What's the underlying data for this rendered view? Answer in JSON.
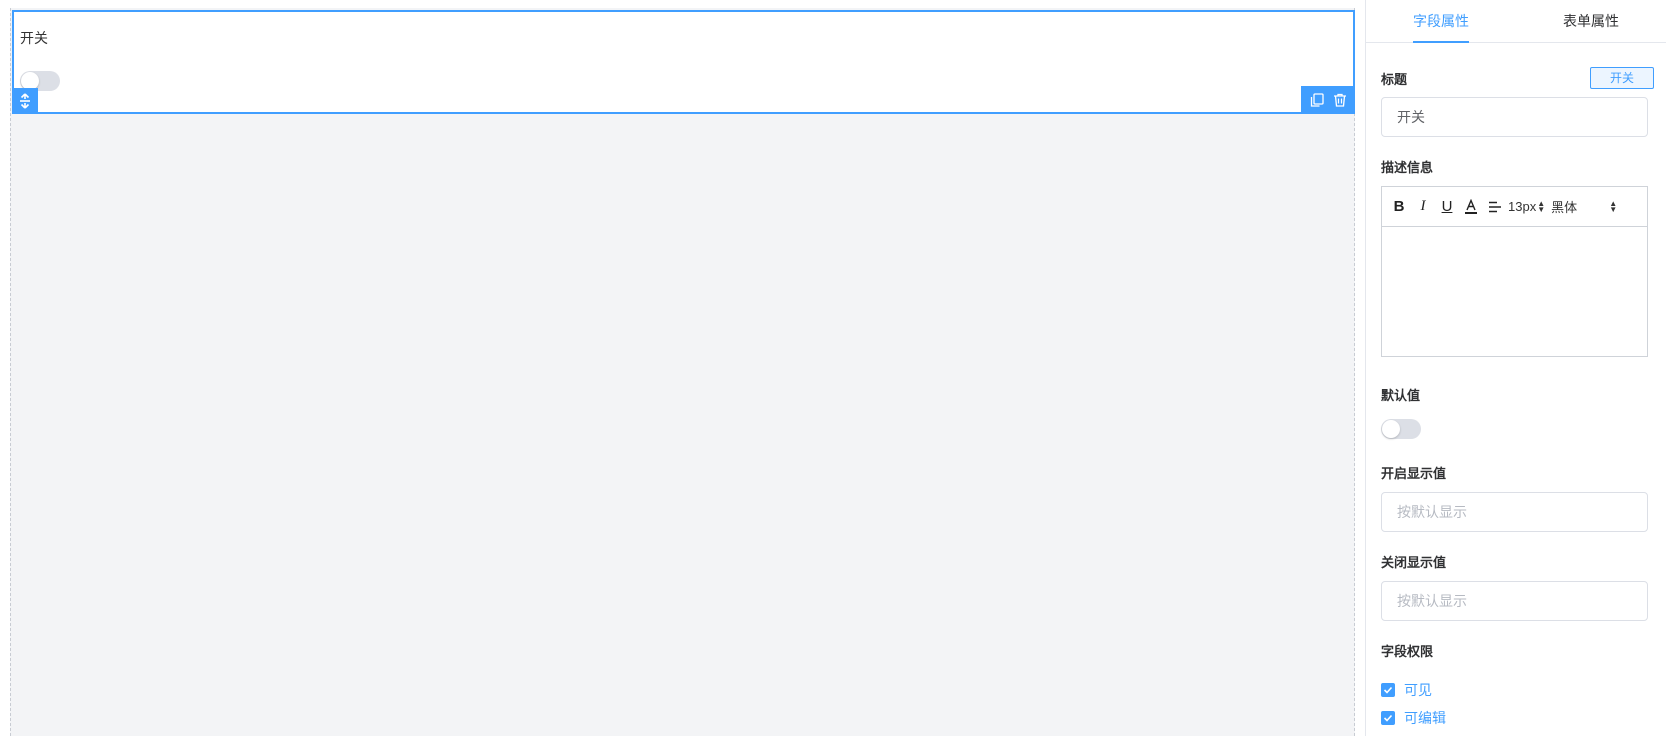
{
  "canvas": {
    "field_label": "开关"
  },
  "panel": {
    "tabs": [
      {
        "label": "字段属性",
        "active": true
      },
      {
        "label": "表单属性",
        "active": false
      }
    ],
    "title_label": "标题",
    "type_badge": "开关",
    "title_value": "开关",
    "desc_label": "描述信息",
    "editor": {
      "bold": "B",
      "italic": "I",
      "underline": "U",
      "color": "A",
      "font_size": "13px",
      "font_family": "黑体"
    },
    "default_label": "默认值",
    "default_on": false,
    "on_label": "开启显示值",
    "on_placeholder": "按默认显示",
    "off_label": "关闭显示值",
    "off_placeholder": "按默认显示",
    "perm_label": "字段权限",
    "permissions": [
      {
        "label": "可见",
        "checked": true
      },
      {
        "label": "可编辑",
        "checked": true
      }
    ]
  },
  "colors": {
    "accent": "#409eff",
    "canvas_bg": "#f3f4f6"
  }
}
